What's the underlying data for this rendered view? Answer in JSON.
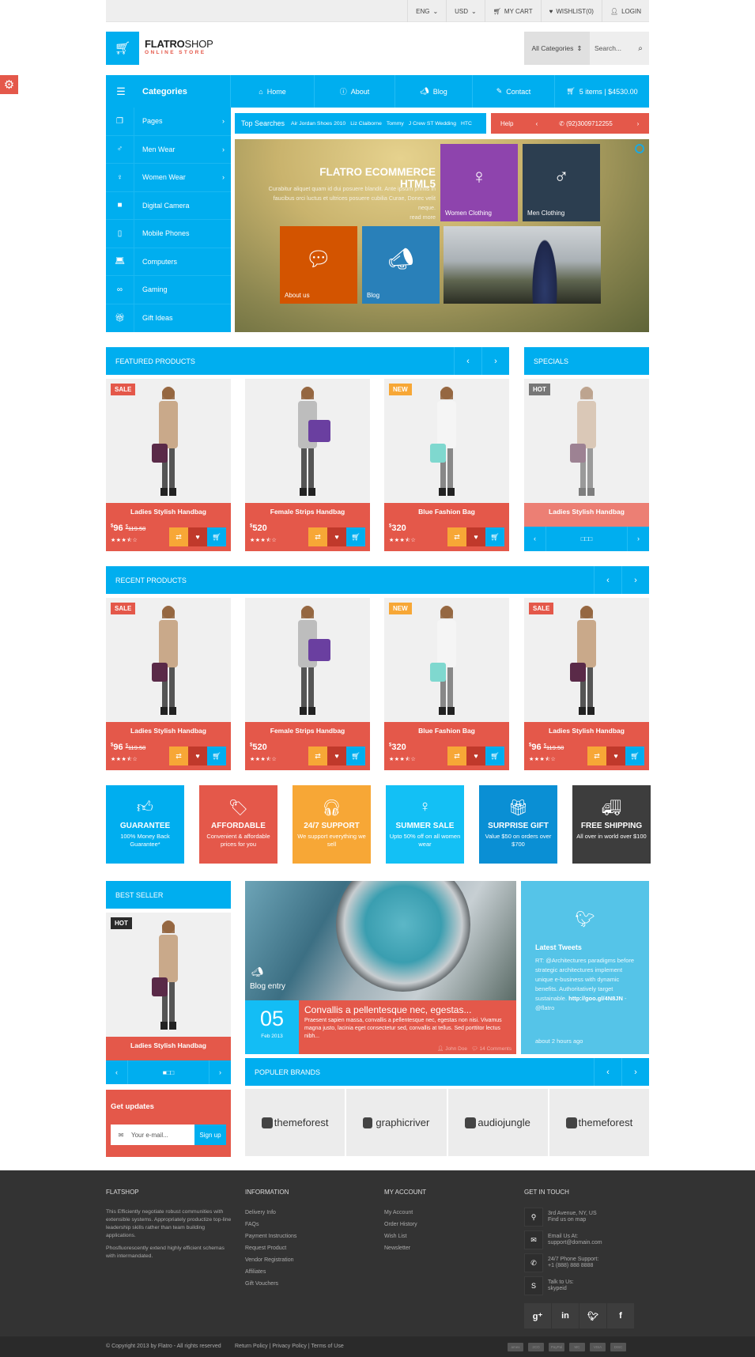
{
  "topbar": {
    "language": "ENG",
    "currency": "USD",
    "cart": "MY CART",
    "wishlist": "WISHLIST(0)",
    "login": "LOGIN"
  },
  "logo": {
    "brand_bold": "FLATRO",
    "brand_light": "SHOP",
    "tagline": "ONLINE STORE"
  },
  "search": {
    "category": "All Categories",
    "placeholder": "Search..."
  },
  "nav": {
    "categories_label": "Categories",
    "items": [
      {
        "label": "Home",
        "icon": "home-icon"
      },
      {
        "label": "About",
        "icon": "info-icon"
      },
      {
        "label": "Blog",
        "icon": "megaphone-icon"
      },
      {
        "label": "Contact",
        "icon": "edit-icon"
      }
    ],
    "cart_summary": "5 items | $4530.00"
  },
  "sidebar": {
    "items": [
      {
        "label": "Pages",
        "icon": "pages-icon",
        "has_submenu": true
      },
      {
        "label": "Men Wear",
        "icon": "male-icon",
        "has_submenu": true
      },
      {
        "label": "Women Wear",
        "icon": "female-icon",
        "has_submenu": true
      },
      {
        "label": "Digital Camera",
        "icon": "video-camera-icon",
        "has_submenu": false
      },
      {
        "label": "Mobile Phones",
        "icon": "mobile-icon",
        "has_submenu": false
      },
      {
        "label": "Computers",
        "icon": "laptop-icon",
        "has_submenu": false
      },
      {
        "label": "Gaming",
        "icon": "gamepad-icon",
        "has_submenu": false
      },
      {
        "label": "Gift Ideas",
        "icon": "gift-icon",
        "has_submenu": false
      }
    ]
  },
  "top_searches": {
    "label": "Top Searches",
    "terms": [
      "Air Jordan Shoes 2010",
      "Liz Claiborne",
      "Tommy",
      "J Crew ST Wedding",
      "HTC"
    ]
  },
  "help_bar": {
    "label": "Help",
    "phone": "(92)3009712255"
  },
  "banner": {
    "title": "FLATRO ECOMMERCE HTML5",
    "description": "Curabitur aliquet quam id dui posuere blandit. Ante ipsum primis in faucibus orci luctus et ultrices posuere cubilia Curae, Donec velit neque.",
    "read_more": "read more",
    "tiles": [
      {
        "label": "Women Clothing",
        "color": "#8e44ad"
      },
      {
        "label": "Men Clothing",
        "color": "#2c3e50"
      },
      {
        "label": "About us",
        "color": "#d35400"
      },
      {
        "label": "Blog",
        "color": "#2980b9"
      }
    ]
  },
  "featured": {
    "title": "FEATURED PRODUCTS",
    "products": [
      {
        "name": "Ladies Stylish Handbag",
        "price": "96",
        "old_price": "119.50",
        "badge": "SALE",
        "badge_color": "#e4584a",
        "rating": 3.5
      },
      {
        "name": "Female Strips Handbag",
        "price": "520",
        "old_price": "",
        "badge": "",
        "badge_color": "",
        "rating": 3.5
      },
      {
        "name": "Blue Fashion Bag",
        "price": "320",
        "old_price": "",
        "badge": "NEW",
        "badge_color": "#f7a736",
        "rating": 3.5
      }
    ]
  },
  "specials": {
    "title": "SPECIALS",
    "product": {
      "name": "Ladies Stylish Handbag",
      "badge": "HOT"
    }
  },
  "recent": {
    "title": "RECENT PRODUCTS",
    "products": [
      {
        "name": "Ladies Stylish Handbag",
        "price": "96",
        "old_price": "119.50",
        "badge": "SALE",
        "badge_color": "#e4584a",
        "rating": 3.5
      },
      {
        "name": "Female Strips Handbag",
        "price": "520",
        "old_price": "",
        "badge": "",
        "badge_color": "",
        "rating": 3.5
      },
      {
        "name": "Blue Fashion Bag",
        "price": "320",
        "old_price": "",
        "badge": "NEW",
        "badge_color": "#f7a736",
        "rating": 3.5
      },
      {
        "name": "Ladies Stylish Handbag",
        "price": "96",
        "old_price": "119.50",
        "badge": "SALE",
        "badge_color": "#e4584a",
        "rating": 3.5
      }
    ]
  },
  "features": [
    {
      "title": "GUARANTEE",
      "desc": "100% Money Back Guarantee*",
      "icon": "thumbs-up-icon",
      "color": "#00aeef"
    },
    {
      "title": "AFFORDABLE",
      "desc": "Convenient & affordable prices for you",
      "icon": "tags-icon",
      "color": "#e4584a"
    },
    {
      "title": "24/7 SUPPORT",
      "desc": "We support everything we sell",
      "icon": "headphones-icon",
      "color": "#f7a736"
    },
    {
      "title": "SUMMER SALE",
      "desc": "Upto 50% off on all women wear",
      "icon": "female-icon",
      "color": "#13c0f5"
    },
    {
      "title": "SURPRISE GIFT",
      "desc": "Value $50 on orders over $700",
      "icon": "gift-icon",
      "color": "#0a8fd4"
    },
    {
      "title": "FREE SHIPPING",
      "desc": "All over in world over $100",
      "icon": "truck-icon",
      "color": "#3d3d3d"
    }
  ],
  "best_seller": {
    "title": "BEST SELLER",
    "product": {
      "name": "Ladies Stylish Handbag",
      "badge": "HOT"
    }
  },
  "newsletter": {
    "title": "Get updates",
    "placeholder": "Your e-mail...",
    "button": "Sign up"
  },
  "blog": {
    "label": "Blog entry",
    "day": "05",
    "month_year": "Feb 2013",
    "title": "Convallis a pellentesque nec, egestas...",
    "excerpt": "Praesent sapien massa, convallis a pellentesque nec, egestas non nisi. Vivamus magna justo, lacinia eget consectetur sed, convallis at tellus. Sed porttitor lectus nibh...",
    "author": "John Doe",
    "comments": "14 Comments"
  },
  "tweets": {
    "title": "Latest Tweets",
    "text": "RT: @Architectures paradigms before strategic architectures implement unique e-business with dynamic benefits. Authoritatively target sustainable.",
    "link": "http://goo.gl/4N8JN",
    "handle": "- @flatro",
    "time": "about 2 hours ago"
  },
  "brands": {
    "title": "POPULER BRANDS",
    "items": [
      "themeforest",
      "graphicriver",
      "audiojungle",
      "themeforest"
    ]
  },
  "footer": {
    "about": {
      "title": "FLATSHOP",
      "p1": "This Efficiently negotiate robust communities with extensible systems. Appropriately productize top-line leadership skills rather than team building applications.",
      "p2": "Phosfluorescently extend highly efficient schemas with intermandated."
    },
    "information": {
      "title": "INFORMATION",
      "links": [
        "Delivery Info",
        "FAQs",
        "Payment Instructions",
        "Request Product",
        "Vendor Registration",
        "Affiliates",
        "Gift Vouchers"
      ]
    },
    "account": {
      "title": "MY ACCOUNT",
      "links": [
        "My Account",
        "Order History",
        "Wish List",
        "Newsletter"
      ]
    },
    "contact": {
      "title": "GET IN TOUCH",
      "items": [
        {
          "line1": "3rd Avenue, NY, US",
          "line2": "Find us on map",
          "icon": "map-marker-icon"
        },
        {
          "line1": "Email Us At:",
          "line2": "support@domain.com",
          "icon": "envelope-icon"
        },
        {
          "line1": "24/7 Phone Support:",
          "line2": "+1 (888) 888 8888",
          "icon": "phone-icon"
        },
        {
          "line1": "Talk to Us:",
          "line2": "skypeid",
          "icon": "skype-icon"
        }
      ]
    },
    "social": [
      "g+",
      "in",
      "tw",
      "f"
    ],
    "copyright": "© Copyright 2013 by Flatro - All rights reserved",
    "policy_links": "Return Policy | Privacy Policy | Terms of Use",
    "payments": [
      "amex",
      "2CO",
      "PayPal",
      "MC",
      "VISA",
      "DISC"
    ]
  }
}
